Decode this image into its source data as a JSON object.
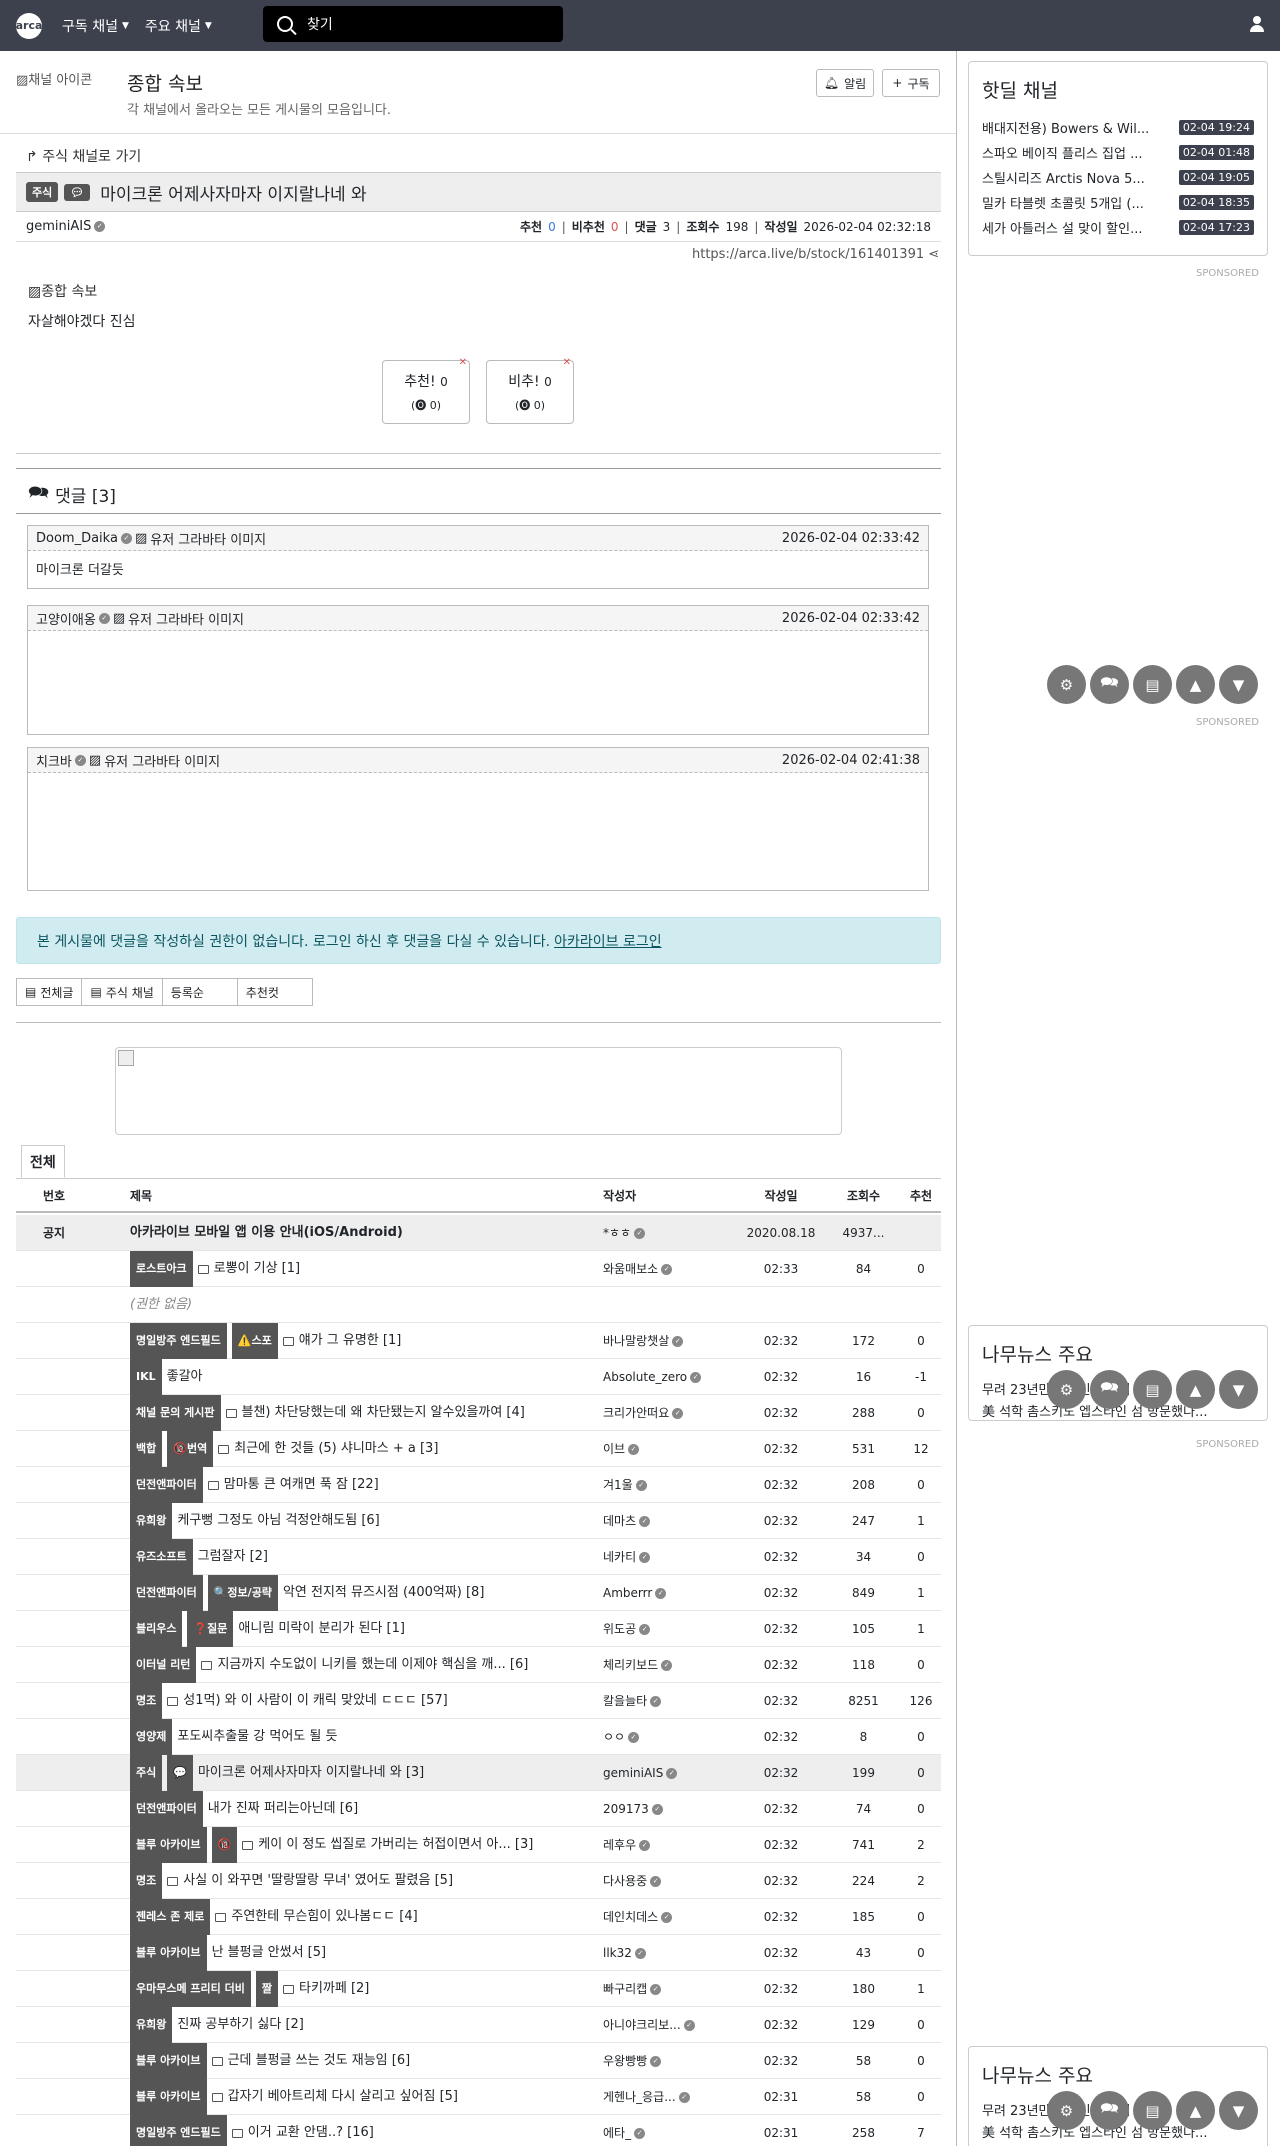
{
  "nav": {
    "logo_text": "arca",
    "menu1": "구독 채널",
    "menu2": "주요 채널",
    "search_placeholder": "찾기"
  },
  "board": {
    "icon_alt": "채널 아이콘",
    "title": "종합 속보",
    "description": "각 채널에서 올라오는 모든 게시물의 모음입니다.",
    "alarm_label": "알림",
    "subscribe_label": "구독"
  },
  "article": {
    "goto_link": "주식 채널로 가기",
    "category_badge": "주식",
    "title": "마이크론 어제사자마자 이지랄나네 와",
    "author": "geminiAIS",
    "up_label": "추천",
    "up_value": "0",
    "down_label": "비추천",
    "down_value": "0",
    "comments_label": "댓글",
    "comments_value": "3",
    "views_label": "조회수",
    "views_value": "198",
    "date_label": "작성일",
    "date_value": "2026-02-04 02:32:18",
    "url": "https://arca.live/b/stock/161401391",
    "image_alt": "종합 속보",
    "body": "자살해야겠다 진심",
    "vote_up_label": "추천!",
    "vote_up_count": "0",
    "vote_up_sub": "(🅞 0)",
    "vote_down_label": "비추!",
    "vote_down_count": "0",
    "vote_down_sub": "(🅞 0)"
  },
  "comments": {
    "header": "댓글 [3]",
    "avatar_alt": "유저 그라바타 이미지",
    "items": [
      {
        "name": "Doom_Daika",
        "time": "2026-02-04 02:33:42",
        "text": "마이크론 더갈듯"
      },
      {
        "name": "고양이애옹",
        "time": "2026-02-04 02:33:42",
        "text": ""
      },
      {
        "name": "치크바",
        "time": "2026-02-04 02:41:38",
        "text": ""
      }
    ]
  },
  "login_alert": {
    "text": "본 게시물에 댓글을 작성하실 권한이 없습니다. 로그인 하신 후 댓글을 다실 수 있습니다.",
    "link": "아카라이브 로그인"
  },
  "filters": [
    "전체글",
    "주식 채널",
    "등록순",
    "추천컷"
  ],
  "list": {
    "tab": "전체",
    "headers": {
      "no": "번호",
      "title": "제목",
      "author": "작성자",
      "date": "작성일",
      "views": "조회수",
      "rate": "추천"
    },
    "notice": {
      "no": "공지",
      "title": "아카라이브 모바일 앱 이용 안내(iOS/Android)",
      "author": "*ㅎㅎ",
      "date": "2020.08.18",
      "views": "4937...",
      "rate": ""
    },
    "rows": [
      {
        "badges": [
          "로스트아크"
        ],
        "icon": true,
        "title": "로뽕이 기상 [1]",
        "author": "와움매보소",
        "date": "02:33",
        "views": "84",
        "rate": "0"
      },
      {
        "badges": [],
        "icon": false,
        "title": "(권한 없음)",
        "muted": true,
        "author": "",
        "date": "",
        "views": "",
        "rate": ""
      },
      {
        "badges": [
          "명일방주 엔드필드",
          "⚠️스포"
        ],
        "icon": true,
        "title": "얘가 그 유명한 [1]",
        "author": "바나말랑챗살",
        "date": "02:32",
        "views": "172",
        "rate": "0"
      },
      {
        "badges": [
          "IKL"
        ],
        "icon": false,
        "title": "좋갈아",
        "author": "Absolute_zero",
        "date": "02:32",
        "views": "16",
        "rate": "-1"
      },
      {
        "badges": [
          "채널 문의 게시판"
        ],
        "icon": true,
        "title": "블챈) 차단당했는데 왜 차단됐는지 알수있을까여 [4]",
        "author": "크리가안떠요",
        "date": "02:32",
        "views": "288",
        "rate": "0"
      },
      {
        "badges": [
          "백합",
          "🔞번역"
        ],
        "icon": true,
        "title": "최근에 한 것들 (5) 샤니마스 + a [3]",
        "author": "이브",
        "date": "02:32",
        "views": "531",
        "rate": "12"
      },
      {
        "badges": [
          "던전앤파이터"
        ],
        "icon": true,
        "title": "맘마통 큰 여캐면 푹 잠 [22]",
        "author": "겨1울",
        "date": "02:32",
        "views": "208",
        "rate": "0"
      },
      {
        "badges": [
          "유희왕"
        ],
        "icon": false,
        "title": "케구뻥 그정도 아님 걱정안해도됨 [6]",
        "author": "데마츠",
        "date": "02:32",
        "views": "247",
        "rate": "1"
      },
      {
        "badges": [
          "유즈소프트"
        ],
        "icon": false,
        "title": "그럼잘자 [2]",
        "author": "네카티",
        "date": "02:32",
        "views": "34",
        "rate": "0"
      },
      {
        "badges": [
          "던전앤파이터",
          "🔍정보/공략"
        ],
        "icon": false,
        "title": "악연 전지적 뮤즈시점 (400억짜) [8]",
        "author": "Amberrr",
        "date": "02:32",
        "views": "849",
        "rate": "1"
      },
      {
        "badges": [
          "블리우스",
          "❓질문"
        ],
        "icon": false,
        "title": "애니림 미락이 분리가 된다 [1]",
        "author": "위도공",
        "date": "02:32",
        "views": "105",
        "rate": "1"
      },
      {
        "badges": [
          "이터널 리턴"
        ],
        "icon": true,
        "title": "지금까지 수도없이 니키를 했는데 이제야 핵심을 깨... [6]",
        "author": "체리키보드",
        "date": "02:32",
        "views": "118",
        "rate": "0"
      },
      {
        "badges": [
          "명조"
        ],
        "icon": true,
        "title": "성1먹) 와 이 사람이 이 캐릭 맞았네 ㄷㄷㄷ [57]",
        "author": "칼을늘타",
        "date": "02:32",
        "views": "8251",
        "rate": "126"
      },
      {
        "badges": [
          "영양제"
        ],
        "icon": false,
        "title": "포도씨추출물 강 먹어도 될 듯",
        "author": "ㅇㅇ",
        "date": "02:32",
        "views": "8",
        "rate": "0"
      },
      {
        "badges": [
          "주식",
          "💬"
        ],
        "icon": false,
        "title": "마이크론 어제사자마자 이지랄나네 와 [3]",
        "author": "geminiAIS",
        "date": "02:32",
        "views": "199",
        "rate": "0",
        "highlight": true
      },
      {
        "badges": [
          "던전앤파이터"
        ],
        "icon": false,
        "title": "내가 진짜 퍼리는아닌데 [6]",
        "author": "209173",
        "date": "02:32",
        "views": "74",
        "rate": "0"
      },
      {
        "badges": [
          "블루 아카이브",
          "🔞"
        ],
        "icon": true,
        "title": "케이 이 정도 씹질로 가버리는 허접이면서 아... [3]",
        "author": "레후우",
        "date": "02:32",
        "views": "741",
        "rate": "2"
      },
      {
        "badges": [
          "명조"
        ],
        "icon": true,
        "title": "사실 이 와꾸면 '딸랑딸랑 무녀' 였어도 팔렸음 [5]",
        "author": "다사용중",
        "date": "02:32",
        "views": "224",
        "rate": "2"
      },
      {
        "badges": [
          "젠레스 존 제로"
        ],
        "icon": true,
        "title": "주연한테 무슨힘이 있나봄ㄷㄷ [4]",
        "author": "데인치데스",
        "date": "02:32",
        "views": "185",
        "rate": "0"
      },
      {
        "badges": [
          "블루 아카이브"
        ],
        "icon": false,
        "title": "난 블펑글 안썼서 [5]",
        "author": "llk32",
        "date": "02:32",
        "views": "43",
        "rate": "0"
      },
      {
        "badges": [
          "우마무스메 프리티 더비",
          "짤"
        ],
        "icon": true,
        "title": "타키까페 [2]",
        "author": "빠구리캡",
        "date": "02:32",
        "views": "180",
        "rate": "1"
      },
      {
        "badges": [
          "유희왕"
        ],
        "icon": false,
        "title": "진짜 공부하기 싫다 [2]",
        "author": "아니야크리보...",
        "date": "02:32",
        "views": "129",
        "rate": "0"
      },
      {
        "badges": [
          "블루 아카이브"
        ],
        "icon": true,
        "title": "근데 블펑글 쓰는 것도 재능임 [6]",
        "author": "우왕빵빵",
        "date": "02:32",
        "views": "58",
        "rate": "0"
      },
      {
        "badges": [
          "블루 아카이브"
        ],
        "icon": true,
        "title": "갑자기 베아트리체 다시 살리고 싶어짐 [5]",
        "author": "게헨나_응급...",
        "date": "02:31",
        "views": "58",
        "rate": "0"
      },
      {
        "badges": [
          "명일방주 엔드필드"
        ],
        "icon": true,
        "title": "이거 교환 안댐..? [16]",
        "author": "에타_",
        "date": "02:31",
        "views": "258",
        "rate": "7"
      }
    ]
  },
  "sidebar": {
    "hot_title": "핫딜 채널",
    "hot_items": [
      {
        "title": "배대지전용) Bowers & Wil...",
        "time": "02-04 19:24"
      },
      {
        "title": "스파오 베이직 플리스 집업 ...",
        "time": "02-04 01:48"
      },
      {
        "title": "스틸시리즈 Arctis Nova 5...",
        "time": "02-04 19:05"
      },
      {
        "title": "밀카 타블렛 초콜릿 5개입 (...",
        "time": "02-04 18:35"
      },
      {
        "title": "세가 아틀러스 설 맞이 할인...",
        "time": "02-04 17:23"
      }
    ],
    "sponsored": "SPONSORED",
    "news_title": "나무뉴스 주요",
    "news_items": [
      "무려 23년만의 국빈 방한이 추진",
      "美 석학 촘스키도 엡스타인 섬 방문했나..."
    ]
  }
}
